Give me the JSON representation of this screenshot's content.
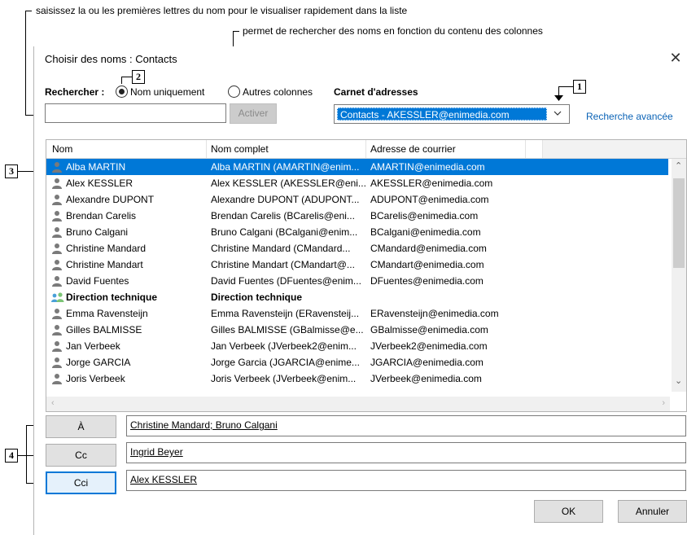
{
  "annotations": {
    "note1": "saisissez la ou les premières lettres du nom pour le visualiser rapidement dans la liste",
    "note2": "permet de rechercher des noms en fonction du contenu des colonnes",
    "callout1": "1",
    "callout2": "2",
    "callout3": "3",
    "callout4": "4"
  },
  "dialog": {
    "title": "Choisir des noms : Contacts",
    "close": "✕"
  },
  "search": {
    "label": "Rechercher :",
    "option_name": "Nom uniquement",
    "option_columns": "Autres colonnes",
    "address_book_label": "Carnet d'adresses",
    "input_value": "",
    "activate": "Activer",
    "address_book_selected": "Contacts - AKESSLER@enimedia.com",
    "advanced": "Recherche avancée"
  },
  "columns": [
    "Nom",
    "Nom complet",
    "Adresse de courrier"
  ],
  "rows": [
    {
      "name": "Alba MARTIN",
      "full": "Alba MARTIN (AMARTIN@enim...",
      "email": "AMARTIN@enimedia.com",
      "group": false
    },
    {
      "name": "Alex KESSLER",
      "full": "Alex KESSLER (AKESSLER@eni...",
      "email": "AKESSLER@enimedia.com",
      "group": false
    },
    {
      "name": "Alexandre DUPONT",
      "full": "Alexandre DUPONT (ADUPONT...",
      "email": "ADUPONT@enimedia.com",
      "group": false
    },
    {
      "name": "Brendan Carelis",
      "full": "Brendan Carelis (BCarelis@eni...",
      "email": "BCarelis@enimedia.com",
      "group": false
    },
    {
      "name": "Bruno Calgani",
      "full": "Bruno Calgani (BCalgani@enim...",
      "email": "BCalgani@enimedia.com",
      "group": false
    },
    {
      "name": "Christine Mandard",
      "full": "Christine Mandard (CMandard...",
      "email": "CMandard@enimedia.com",
      "group": false
    },
    {
      "name": "Christine Mandart",
      "full": "Christine Mandart (CMandart@...",
      "email": "CMandart@enimedia.com",
      "group": false
    },
    {
      "name": "David Fuentes",
      "full": "David Fuentes (DFuentes@enim...",
      "email": "DFuentes@enimedia.com",
      "group": false
    },
    {
      "name": "Direction technique",
      "full": "Direction technique",
      "email": "",
      "group": true
    },
    {
      "name": "Emma Ravensteijn",
      "full": "Emma Ravensteijn (ERavensteij...",
      "email": "ERavensteijn@enimedia.com",
      "group": false
    },
    {
      "name": "Gilles BALMISSE",
      "full": "Gilles BALMISSE (GBalmisse@e...",
      "email": "GBalmisse@enimedia.com",
      "group": false
    },
    {
      "name": "Jan Verbeek",
      "full": "Jan Verbeek (JVerbeek2@enim...",
      "email": "JVerbeek2@enimedia.com",
      "group": false
    },
    {
      "name": "Jorge GARCIA",
      "full": "Jorge Garcia (JGARCIA@enime...",
      "email": "JGARCIA@enimedia.com",
      "group": false
    },
    {
      "name": "Joris Verbeek",
      "full": "Joris Verbeek (JVerbeek@enim...",
      "email": "JVerbeek@enimedia.com",
      "group": false
    }
  ],
  "recipients": {
    "to_label": "À",
    "to_value": "Christine Mandard; Bruno Calgani",
    "cc_label": "Cc",
    "cc_value": "Ingrid Beyer",
    "bcc_label": "Cci",
    "bcc_value": "Alex KESSLER"
  },
  "footer": {
    "ok": "OK",
    "cancel": "Annuler"
  },
  "colors": {
    "selection": "#0078d7",
    "link": "#0b63b6"
  }
}
